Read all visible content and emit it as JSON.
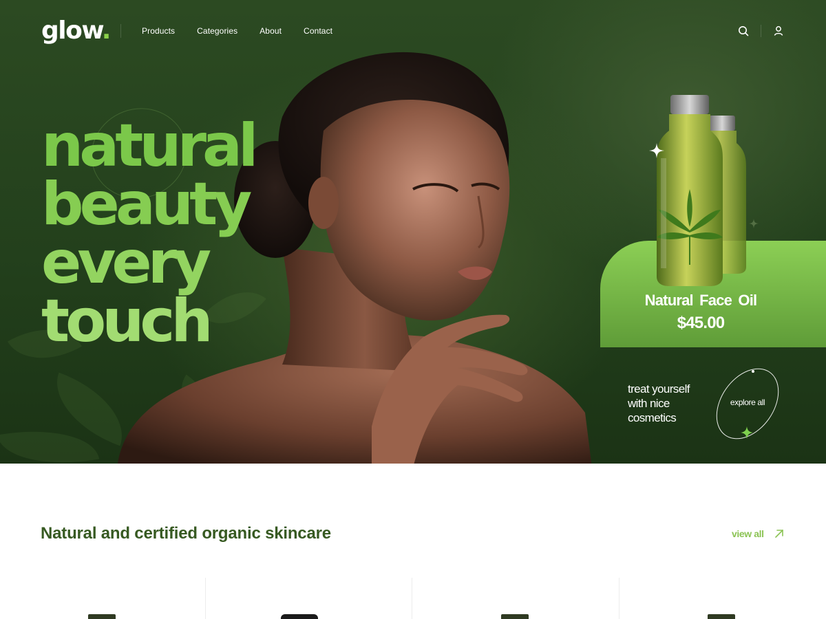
{
  "header": {
    "logo_text": "glow",
    "logo_dot": ".",
    "nav": [
      "Products",
      "Categories",
      "About",
      "Contact"
    ],
    "search_icon": "search-icon",
    "user_icon": "user-icon"
  },
  "hero": {
    "headline": [
      "natural",
      "beauty",
      "every",
      "touch"
    ],
    "product": {
      "name": "Natural Face Oil",
      "price": "$45.00"
    },
    "tagline": [
      "treat yourself",
      "with nice",
      "cosmetics"
    ],
    "explore_label": "explore all"
  },
  "section": {
    "title": "Natural and certified organic skincare",
    "view_all": "view all",
    "view_all_icon": "arrow-up-right-icon"
  },
  "colors": {
    "brand_green": "#8bd04a",
    "hero_dark": "#23401c",
    "section_title": "#375a22",
    "link_green": "#8bc354"
  }
}
